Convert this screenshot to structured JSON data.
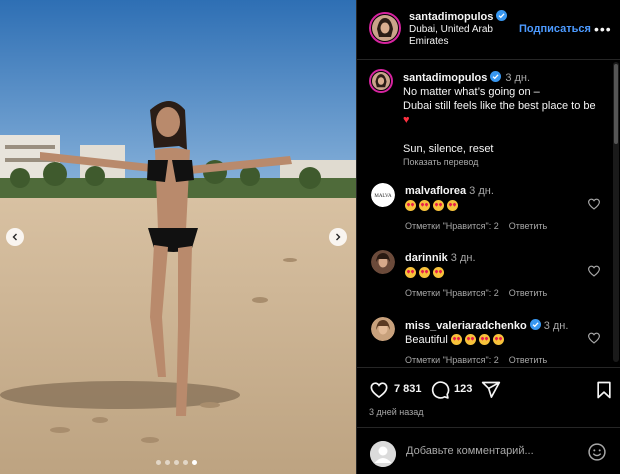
{
  "header": {
    "username": "santadimopulos",
    "location": "Dubai, United Arab Emirates",
    "follow_label": "Подписаться",
    "more_label": "•••"
  },
  "caption": {
    "username": "santadimopulos",
    "time": "3 дн.",
    "lines": [
      "No matter what’s going on –",
      "Dubai still feels like the best place to be"
    ],
    "heart": "♥",
    "line2": "Sun, silence, reset",
    "translate_label": "Показать перевод"
  },
  "comments": [
    {
      "username": "malvaflorea",
      "time": "3 дн.",
      "text": "",
      "emoji_count": 4,
      "verified": false,
      "likes_label": "Отметки \"Нравится\": 2",
      "reply_label": "Ответить",
      "avatar_text": "MALVA"
    },
    {
      "username": "darinnik",
      "time": "3 дн.",
      "text": "",
      "emoji_count": 3,
      "verified": false,
      "likes_label": "Отметки \"Нравится\": 2",
      "reply_label": "Ответить",
      "avatar_text": ""
    },
    {
      "username": "miss_valeriaradchenko",
      "time": "3 дн.",
      "text": "Beautiful",
      "emoji_count": 4,
      "verified": true,
      "likes_label": "Отметки \"Нравится\": 2",
      "reply_label": "Ответить",
      "avatar_text": ""
    }
  ],
  "actions": {
    "likes_count": "7 831",
    "comments_count": "123",
    "posted": "3 дней назад"
  },
  "add_comment": {
    "placeholder": "Добавьте комментарий..."
  },
  "carousel": {
    "dots": 5,
    "active_dot": 4
  },
  "colors": {
    "accent": "#4c9aff",
    "verified": "#3897f0",
    "heart": "#ff3040",
    "panel_bg": "#000000",
    "divider": "#262626"
  },
  "icons": {
    "heart": "heart-icon",
    "comment": "comment-icon",
    "share": "share-icon",
    "save": "bookmark-icon",
    "emoji": "smiley-icon",
    "prev": "chevron-left-icon",
    "next": "chevron-right-icon",
    "verified": "verified-badge-icon"
  }
}
